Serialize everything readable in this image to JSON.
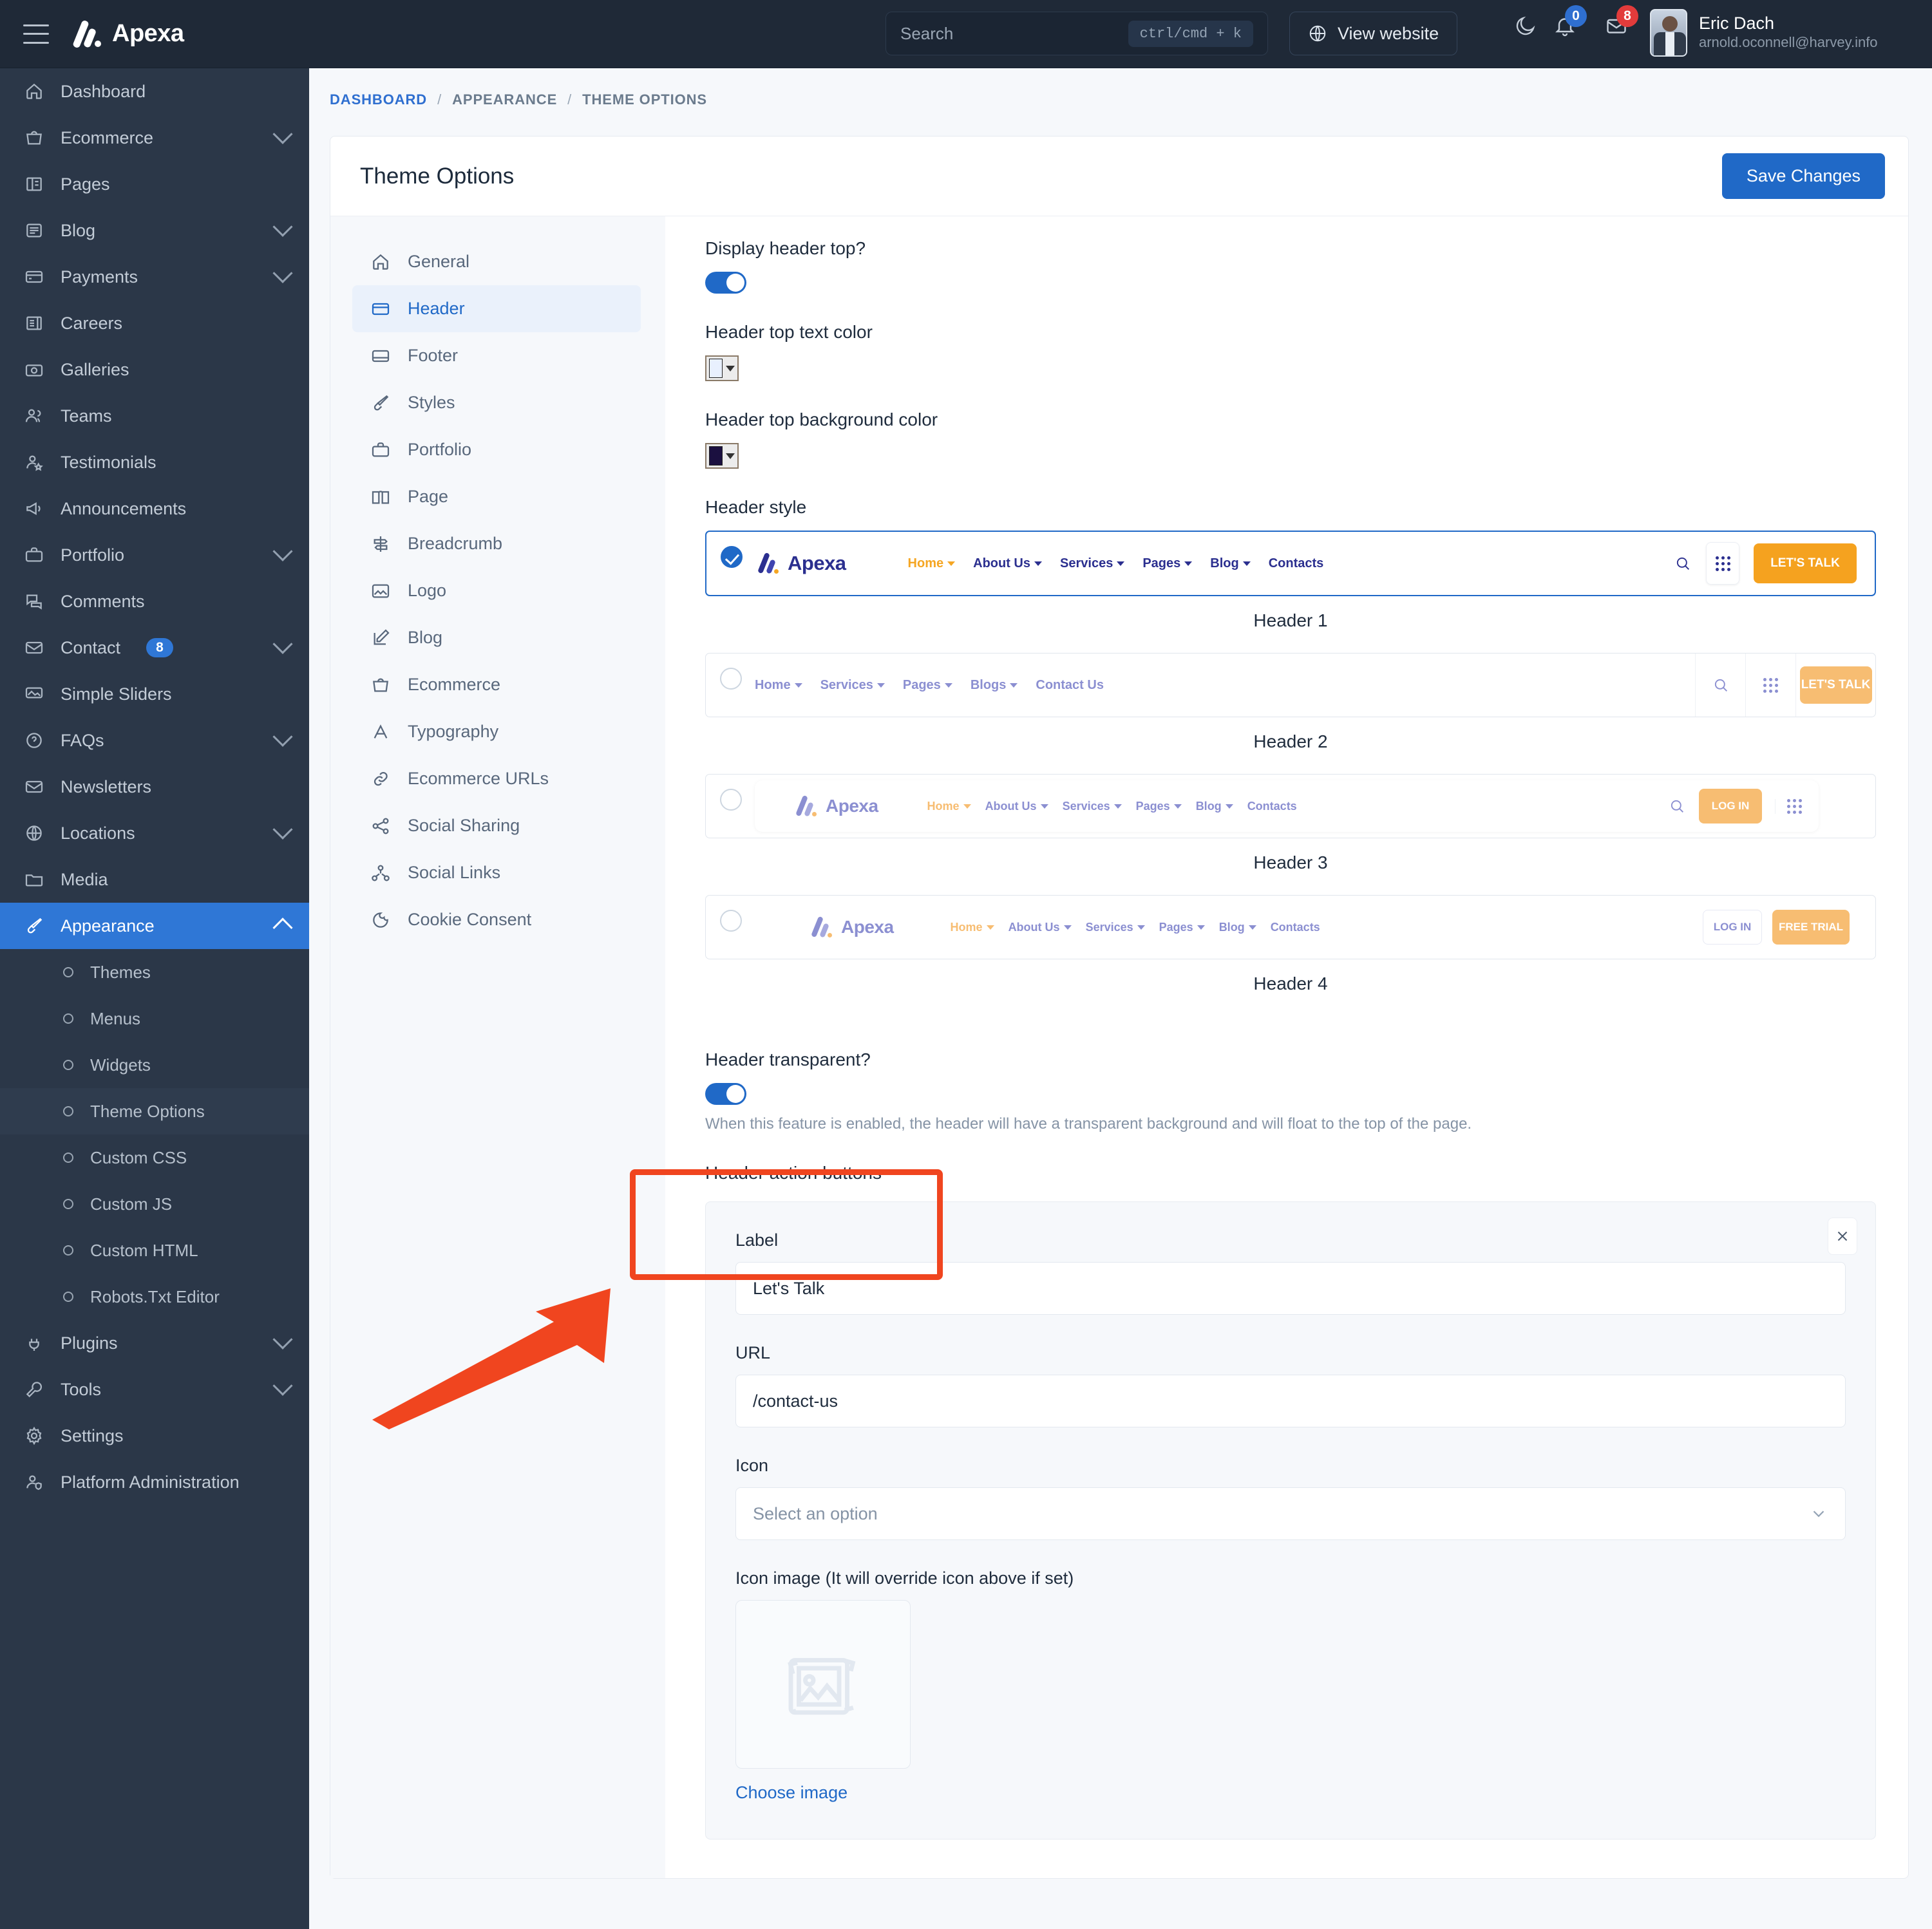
{
  "topbar": {
    "menu_icon": "hamburger-icon",
    "brand": "Apexa",
    "search": {
      "placeholder": "Search",
      "shortcut": "ctrl/cmd + k"
    },
    "view_website": "View website",
    "dark_mode_icon": "moon-icon",
    "notifications": {
      "icon": "bell-icon",
      "count": "0"
    },
    "messages": {
      "icon": "envelope-icon",
      "count": "8"
    },
    "user": {
      "name": "Eric Dach",
      "email": "arnold.oconnell@harvey.info"
    }
  },
  "sidebar": {
    "items": [
      {
        "label": "Dashboard",
        "icon": "home-icon",
        "chevron": false
      },
      {
        "label": "Ecommerce",
        "icon": "bag-icon",
        "chevron": true
      },
      {
        "label": "Pages",
        "icon": "book-icon",
        "chevron": false
      },
      {
        "label": "Blog",
        "icon": "list-icon",
        "chevron": true
      },
      {
        "label": "Payments",
        "icon": "card-icon",
        "chevron": true
      },
      {
        "label": "Careers",
        "icon": "briefcase-news-icon",
        "chevron": false
      },
      {
        "label": "Galleries",
        "icon": "camera-icon",
        "chevron": false
      },
      {
        "label": "Teams",
        "icon": "users-icon",
        "chevron": false
      },
      {
        "label": "Testimonials",
        "icon": "user-star-icon",
        "chevron": false
      },
      {
        "label": "Announcements",
        "icon": "megaphone-icon",
        "chevron": false
      },
      {
        "label": "Portfolio",
        "icon": "briefcase-icon",
        "chevron": true
      },
      {
        "label": "Comments",
        "icon": "comments-icon",
        "chevron": false
      },
      {
        "label": "Contact",
        "icon": "mail-icon",
        "chevron": true,
        "badge": "8"
      },
      {
        "label": "Simple Sliders",
        "icon": "slider-image-icon",
        "chevron": false
      },
      {
        "label": "FAQs",
        "icon": "question-icon",
        "chevron": true
      },
      {
        "label": "Newsletters",
        "icon": "mail-icon",
        "chevron": false
      },
      {
        "label": "Locations",
        "icon": "globe-icon",
        "chevron": true
      },
      {
        "label": "Media",
        "icon": "folder-icon",
        "chevron": false
      },
      {
        "label": "Appearance",
        "icon": "brush-icon",
        "chevron": true,
        "active": true
      }
    ],
    "appearance_children": [
      {
        "label": "Themes"
      },
      {
        "label": "Menus"
      },
      {
        "label": "Widgets"
      },
      {
        "label": "Theme Options",
        "active": true
      },
      {
        "label": "Custom CSS"
      },
      {
        "label": "Custom JS"
      },
      {
        "label": "Custom HTML"
      },
      {
        "label": "Robots.Txt Editor"
      }
    ],
    "items_after": [
      {
        "label": "Plugins",
        "icon": "plug-icon",
        "chevron": true
      },
      {
        "label": "Tools",
        "icon": "wrench-icon",
        "chevron": true
      },
      {
        "label": "Settings",
        "icon": "gear-icon",
        "chevron": false
      },
      {
        "label": "Platform Administration",
        "icon": "user-shield-icon",
        "chevron": false
      }
    ]
  },
  "breadcrumb": {
    "home": "DASHBOARD",
    "sep": "/",
    "middle": "APPEARANCE",
    "current": "THEME OPTIONS"
  },
  "page": {
    "title": "Theme Options",
    "save_label": "Save Changes"
  },
  "settings_nav": [
    {
      "label": "General",
      "icon": "home-icon"
    },
    {
      "label": "Header",
      "icon": "header-icon",
      "active": true
    },
    {
      "label": "Footer",
      "icon": "footer-icon"
    },
    {
      "label": "Styles",
      "icon": "brush-icon"
    },
    {
      "label": "Portfolio",
      "icon": "briefcase-icon"
    },
    {
      "label": "Page",
      "icon": "book-open-icon"
    },
    {
      "label": "Breadcrumb",
      "icon": "signpost-icon"
    },
    {
      "label": "Logo",
      "icon": "image-icon"
    },
    {
      "label": "Blog",
      "icon": "pencil-icon"
    },
    {
      "label": "Ecommerce",
      "icon": "bag-icon"
    },
    {
      "label": "Typography",
      "icon": "letter-a-icon"
    },
    {
      "label": "Ecommerce URLs",
      "icon": "link-icon"
    },
    {
      "label": "Social Sharing",
      "icon": "share-icon"
    },
    {
      "label": "Social Links",
      "icon": "network-icon"
    },
    {
      "label": "Cookie Consent",
      "icon": "cookie-icon"
    }
  ],
  "form": {
    "display_header_top_label": "Display header top?",
    "display_header_top_value": "on",
    "header_top_text_color_label": "Header top text color",
    "header_top_text_color_value": "#e8f0fe",
    "header_top_bg_color_label": "Header top background color",
    "header_top_bg_color_value": "#1b1040",
    "header_style_label": "Header style",
    "header_transparent_label": "Header transparent?",
    "header_transparent_value": "on",
    "header_transparent_help": "When this feature is enabled, the header will have a transparent background and will float to the top of the page.",
    "header_action_buttons_label": "Header action buttons",
    "action_button": {
      "close_icon": "close-icon",
      "label_label": "Label",
      "label_value": "Let's Talk",
      "url_label": "URL",
      "url_value": "/contact-us",
      "icon_label": "Icon",
      "icon_value": "Select an option",
      "icon_image_label": "Icon image (It will override icon above if set)",
      "choose_image": "Choose image"
    }
  },
  "header_styles": [
    {
      "caption": "Header 1",
      "selected": true,
      "logo": "Apexa",
      "nav": [
        "Home",
        "About Us",
        "Services",
        "Pages",
        "Blog",
        "Contacts"
      ],
      "nav_carets": [
        true,
        true,
        true,
        true,
        true,
        false
      ],
      "active_nav": "Home",
      "search_icon": "search-icon",
      "grid_icon": "grid-icon",
      "buttons": [
        {
          "label": "LET'S TALK",
          "style": "solid-orange"
        }
      ]
    },
    {
      "caption": "Header 2",
      "selected": false,
      "logo": "",
      "nav": [
        "Home",
        "Services",
        "Pages",
        "Blogs",
        "Contact Us"
      ],
      "nav_carets": [
        true,
        true,
        true,
        true,
        false
      ],
      "active_nav": "",
      "search_icon": "search-icon",
      "grid_icon": "grid-icon",
      "buttons": [
        {
          "label": "LET'S TALK",
          "style": "solid-orange"
        }
      ]
    },
    {
      "caption": "Header 3",
      "selected": false,
      "logo": "Apexa",
      "nav": [
        "Home",
        "About Us",
        "Services",
        "Pages",
        "Blog",
        "Contacts"
      ],
      "nav_carets": [
        true,
        true,
        true,
        true,
        true,
        false
      ],
      "active_nav": "Home",
      "search_icon": "search-icon",
      "grid_icon": "grid-icon",
      "buttons": [
        {
          "label": "LOG IN",
          "style": "solid-orange"
        }
      ]
    },
    {
      "caption": "Header 4",
      "selected": false,
      "logo": "Apexa",
      "nav": [
        "Home",
        "About Us",
        "Services",
        "Pages",
        "Blog",
        "Contacts"
      ],
      "nav_carets": [
        true,
        true,
        true,
        true,
        true,
        false
      ],
      "active_nav": "Home",
      "buttons": [
        {
          "label": "LOG IN",
          "style": "outline"
        },
        {
          "label": "FREE TRIAL",
          "style": "solid-orange"
        }
      ]
    }
  ],
  "colors": {
    "accent_blue": "#2069c7",
    "sidebar_bg": "#2b3748",
    "topbar_bg": "#1f2937",
    "annotation_red": "#f0451f",
    "preview_orange": "#f5a623",
    "preview_navy": "#2b2f8f"
  }
}
